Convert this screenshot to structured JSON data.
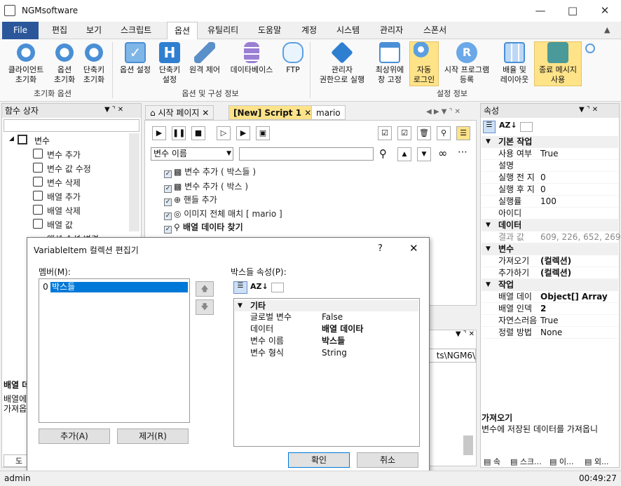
{
  "app": {
    "title": "NGMsoftware"
  },
  "menu": {
    "tabs": [
      "File",
      "편집",
      "보기",
      "스크립트",
      "옵션",
      "유틸리티",
      "도움말",
      "계정",
      "시스템",
      "관리자",
      "스폰서"
    ]
  },
  "ribbon": {
    "buttons": [
      {
        "label1": "클라이언트",
        "label2": "초기화"
      },
      {
        "label1": "옵션",
        "label2": "초기화"
      },
      {
        "label1": "단축키",
        "label2": "초기화"
      },
      {
        "label1": "옵션 설정",
        "label2": ""
      },
      {
        "label1": "단축키",
        "label2": "설정"
      },
      {
        "label1": "원격 제어",
        "label2": ""
      },
      {
        "label1": "데이타베이스",
        "label2": ""
      },
      {
        "label1": "FTP",
        "label2": ""
      },
      {
        "label1": "관리자",
        "label2": "권한으로 실행"
      },
      {
        "label1": "최상위에",
        "label2": "창 고정"
      },
      {
        "label1": "자동",
        "label2": "로그인"
      },
      {
        "label1": "시작 프로그램",
        "label2": "등록"
      },
      {
        "label1": "배율 및",
        "label2": "레이아웃"
      },
      {
        "label1": "종료 메시지",
        "label2": "사용"
      }
    ],
    "groups": [
      "초기화 옵션",
      "옵션 및 구성 정보",
      "설정 정보"
    ]
  },
  "left_panel": {
    "title": "함수 상자",
    "root": "변수",
    "items": [
      "변수 추가",
      "변수 값 수정",
      "변수 삭제",
      "배열 추가",
      "배열 삭제",
      "배열 값",
      "액션 속성 변경"
    ],
    "bottom_title": "배열 데",
    "bottom_desc1": "배열에",
    "bottom_desc2": "가져옵",
    "bottom_tab": "도"
  },
  "doc_tabs": [
    "시작 페이지",
    "[New] Script 1",
    "mario"
  ],
  "editor": {
    "dropdown": "변수 이름",
    "search_value": "",
    "steps": [
      {
        "text": "변수 추가 ( 박스들 )",
        "bold": false
      },
      {
        "text": "변수 추가 ( 박스 )",
        "bold": false
      },
      {
        "text": "핸들 추가",
        "bold": false
      },
      {
        "text": "이미지 전체 매치 [ mario ]",
        "bold": false
      },
      {
        "text": "배열 데이타 찾기",
        "bold": true
      }
    ]
  },
  "output": {
    "path": "ts\\NGM6\\"
  },
  "properties": {
    "title": "속성",
    "categories": [
      {
        "name": "기본 작업",
        "rows": [
          [
            "사용 여부",
            "True"
          ],
          [
            "설명",
            ""
          ],
          [
            "실행 전 지",
            "0"
          ],
          [
            "실행 후 지",
            "0"
          ],
          [
            "실행률",
            "100"
          ],
          [
            "아이디",
            ""
          ]
        ]
      },
      {
        "name": "데이터",
        "rows": [
          [
            "결과 값",
            "609, 226, 652, 269"
          ]
        ]
      },
      {
        "name": "변수",
        "rows": [
          [
            "가져오기",
            "(컬렉션)"
          ],
          [
            "추가하기",
            "(컬렉션)"
          ]
        ]
      },
      {
        "name": "작업",
        "rows": [
          [
            "배열 데이",
            "Object[] Array"
          ],
          [
            "배열 인덱",
            "2"
          ],
          [
            "자연스러음",
            "True"
          ],
          [
            "정렬 방법",
            "None"
          ]
        ]
      }
    ],
    "desc_title": "가져오기",
    "desc_text": "변수에 저장된 데이터를 가져옵니",
    "bottom_tabs": [
      "속",
      "스크...",
      "이...",
      "외..."
    ]
  },
  "dialog": {
    "title": "VariableItem 컬렉션 편집기",
    "help": "?",
    "members_label": "멤버(M):",
    "member_index": "0",
    "member_name": "박스들",
    "props_label": "박스들 속성(P):",
    "category": "기타",
    "rows": [
      [
        "글로벌 변수",
        "False"
      ],
      [
        "데이터",
        "배열 데이타"
      ],
      [
        "변수 이름",
        "박스들"
      ],
      [
        "변수 형식",
        "String"
      ]
    ],
    "add_button": "추가(A)",
    "remove_button": "제거(R)",
    "ok_button": "확인",
    "cancel_button": "취소"
  },
  "status": {
    "user": "admin",
    "time": "00:49:27"
  }
}
